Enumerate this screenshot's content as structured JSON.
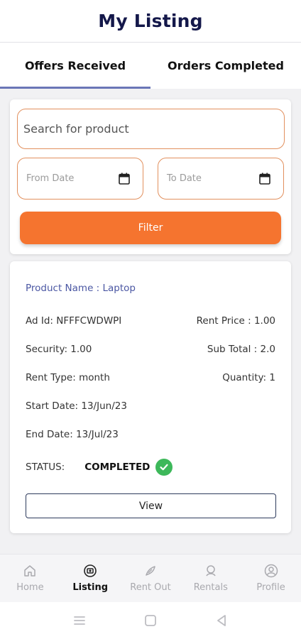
{
  "header": {
    "title": "My Listing"
  },
  "tabs": [
    {
      "label": "Offers Received",
      "active": true
    },
    {
      "label": "Orders Completed",
      "active": false
    }
  ],
  "filter": {
    "search_placeholder": "Search for product",
    "from_date_placeholder": "From Date",
    "to_date_placeholder": "To Date",
    "button_label": "Filter"
  },
  "order": {
    "product_name": "Product Name : Laptop",
    "ad_id": "Ad Id: NFFFCWDWPI",
    "rent_price": "Rent Price : 1.00",
    "security": "Security: 1.00",
    "sub_total": "Sub Total : 2.0",
    "rent_type": "Rent Type: month",
    "quantity": "Quantity: 1",
    "start_date": "Start Date: 13/Jun/23",
    "end_date": "End Date: 13/Jul/23",
    "status_label": "STATUS:",
    "status_value": "COMPLETED",
    "view_label": "View"
  },
  "bottom_nav": [
    {
      "label": "Home",
      "icon": "home-icon",
      "active": false
    },
    {
      "label": "Listing",
      "icon": "listing-icon",
      "active": true
    },
    {
      "label": "Rent Out",
      "icon": "rent-out-icon",
      "active": false
    },
    {
      "label": "Rentals",
      "icon": "rentals-icon",
      "active": false
    },
    {
      "label": "Profile",
      "icon": "profile-icon",
      "active": false
    }
  ],
  "colors": {
    "accent": "#f5742f",
    "title": "#14184a",
    "tab_indicator": "#6a76b7",
    "product_name": "#4b57a3",
    "success": "#3db85a"
  }
}
